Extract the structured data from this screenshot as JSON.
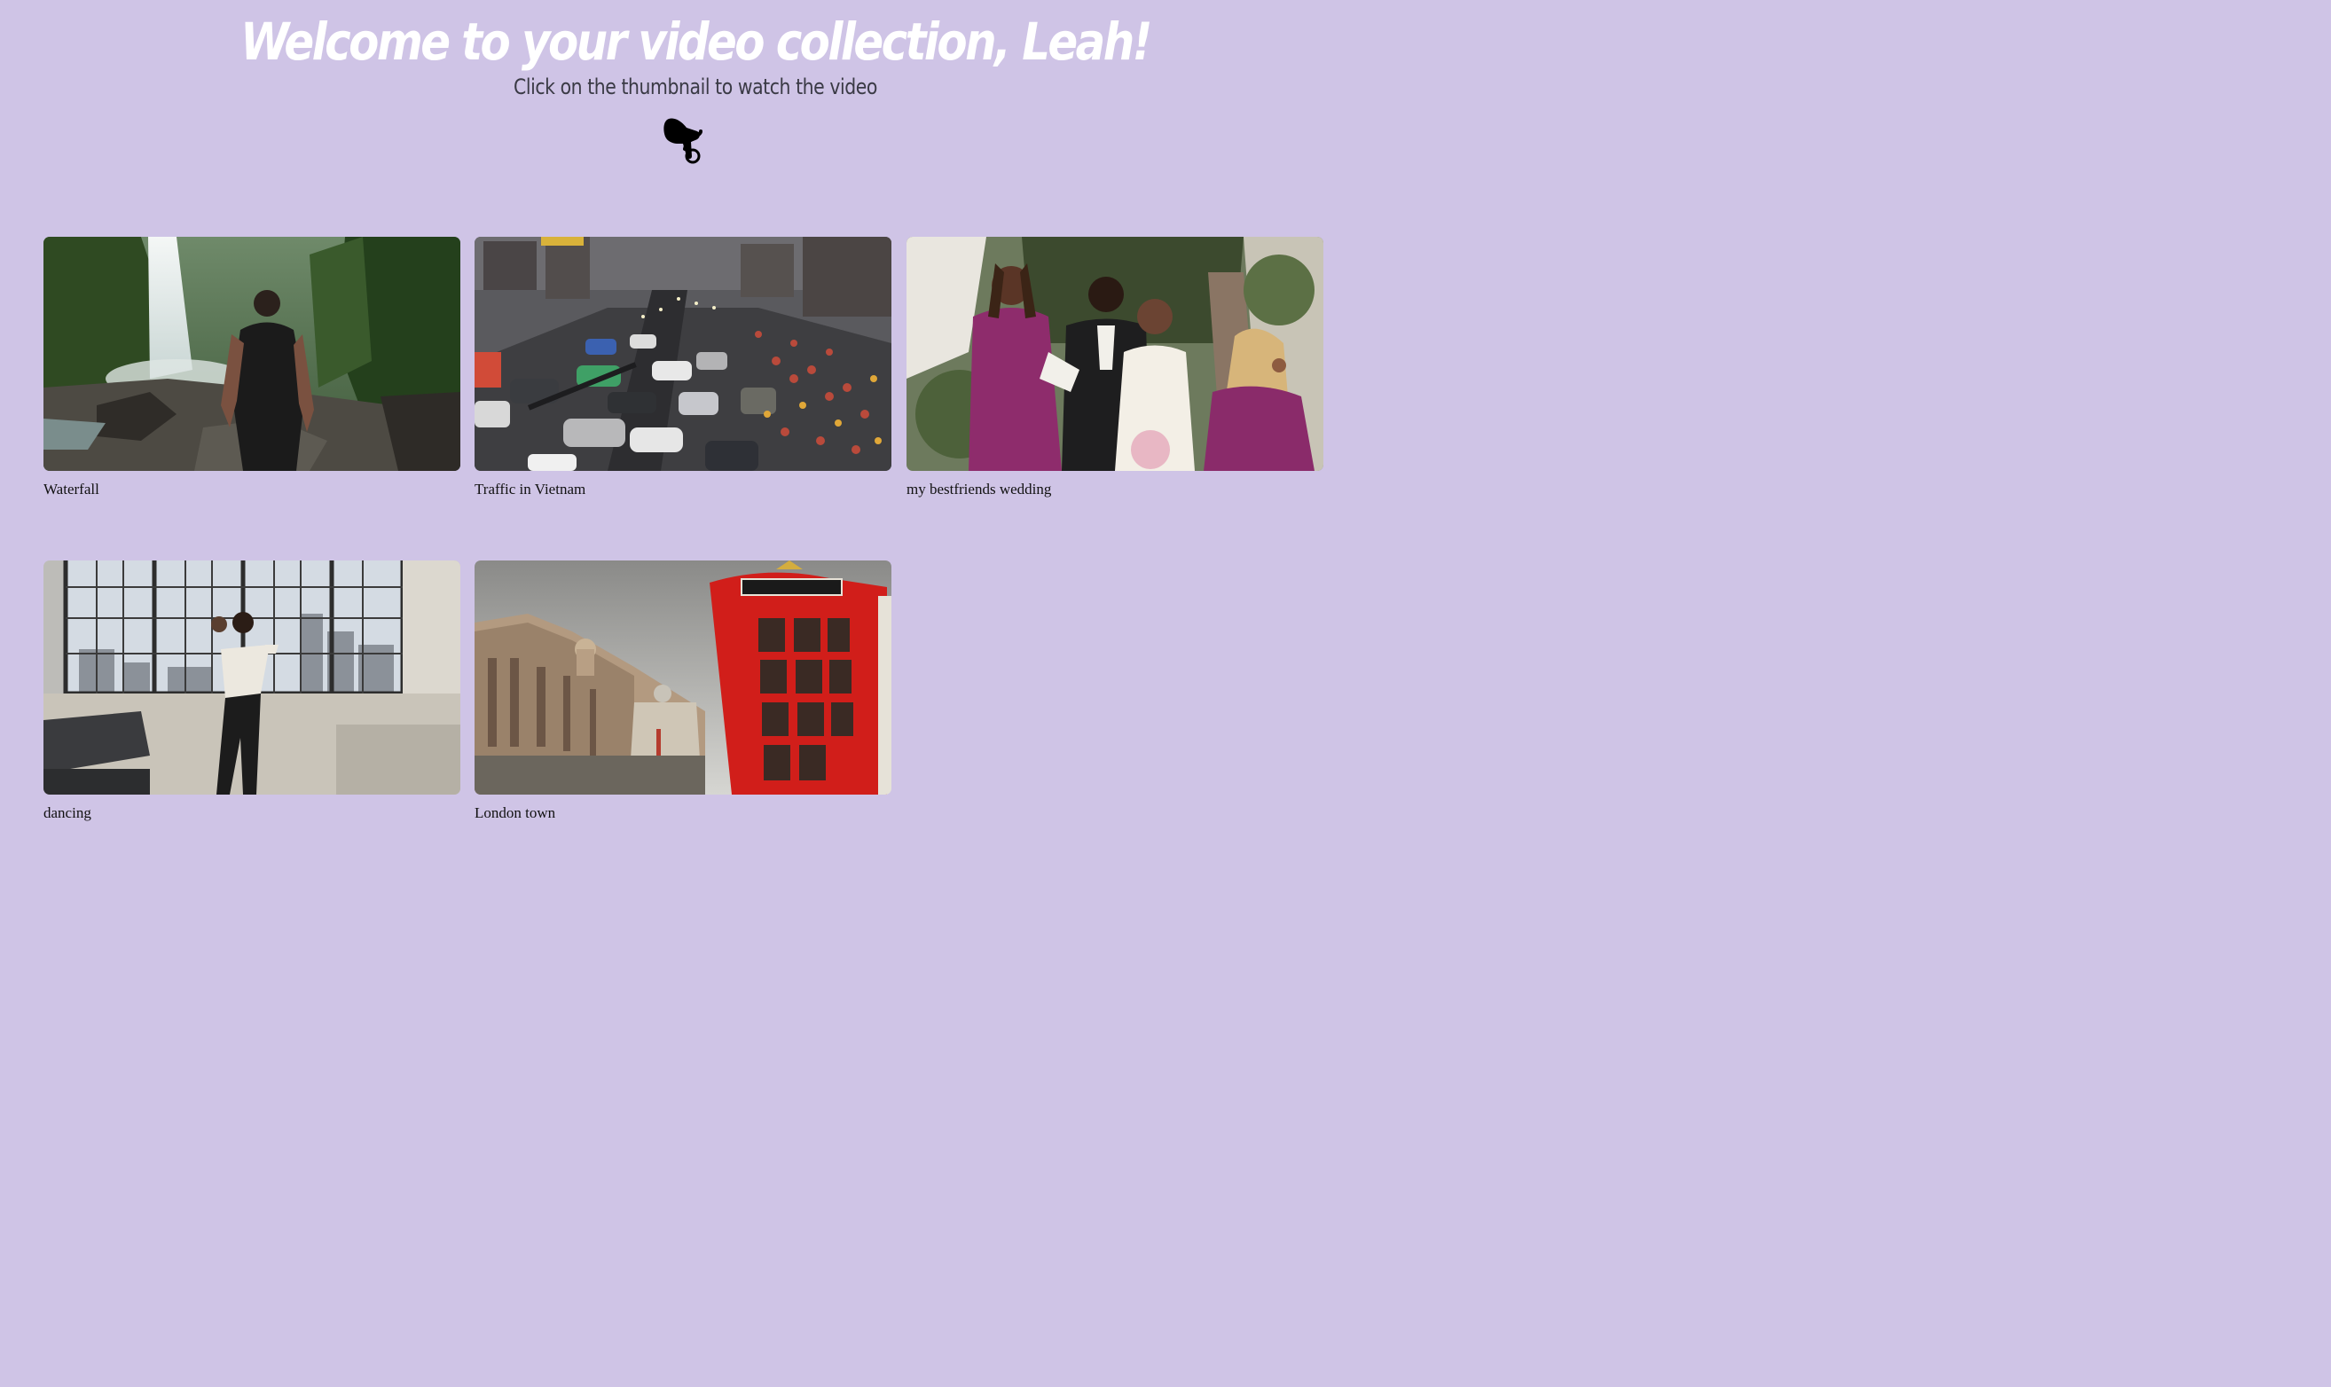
{
  "header": {
    "title": "Welcome to your video collection, Leah!",
    "subtitle": "Click on the thumbnail to watch the video",
    "pointer_icon": "hand-pointing-down-icon"
  },
  "videos": [
    {
      "title": "Waterfall",
      "thumbnail_icon": "waterfall-thumbnail"
    },
    {
      "title": "Traffic in Vietnam",
      "thumbnail_icon": "traffic-thumbnail"
    },
    {
      "title": "my bestfriends wedding",
      "thumbnail_icon": "wedding-thumbnail"
    },
    {
      "title": "dancing",
      "thumbnail_icon": "dancing-thumbnail"
    },
    {
      "title": "London town",
      "thumbnail_icon": "london-thumbnail"
    }
  ],
  "colors": {
    "background": "#cfc4e6",
    "title": "#ffffff",
    "subtitle": "#3a3a45",
    "caption": "#111111"
  }
}
